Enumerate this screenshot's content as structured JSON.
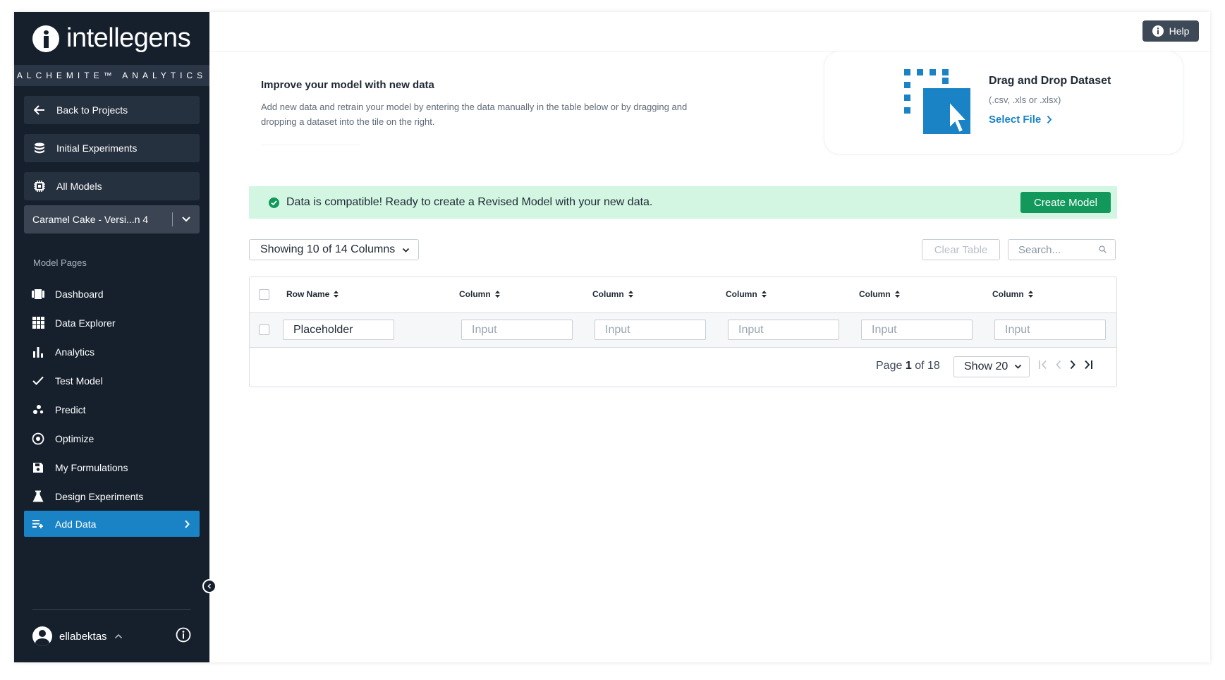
{
  "brand": {
    "name": "intellegens",
    "subtitle": "ALCHEMITE™ ANALYTICS"
  },
  "sidebar": {
    "back_label": "Back to Projects",
    "experiments_label": "Initial Experiments",
    "models_label": "All Models",
    "version_select": "Caramel Cake - Versi...n 4",
    "section_label": "Model Pages",
    "items": [
      {
        "label": "Dashboard",
        "icon": "dashboard-icon"
      },
      {
        "label": "Data Explorer",
        "icon": "grid-icon"
      },
      {
        "label": "Analytics",
        "icon": "bar-chart-icon"
      },
      {
        "label": "Test Model",
        "icon": "check-icon"
      },
      {
        "label": "Predict",
        "icon": "scatter-icon"
      },
      {
        "label": "Optimize",
        "icon": "target-icon"
      },
      {
        "label": "My Formulations",
        "icon": "save-icon"
      },
      {
        "label": "Design Experiments",
        "icon": "flask-icon"
      },
      {
        "label": "Add Data",
        "icon": "add-list-icon",
        "active": true
      }
    ],
    "user": "ellabektas"
  },
  "header": {
    "help_label": "Help"
  },
  "intro": {
    "title": "Improve your model with new data",
    "text": "Add new data and retrain your model by entering the data manually in the table below or by dragging and dropping a dataset into the tile on the right."
  },
  "drop_tile": {
    "title": "Drag and Drop Dataset",
    "formats": "(.csv, .xls or .xlsx)",
    "link": "Select File"
  },
  "alert": {
    "message": "Data is compatible! Ready to create a Revised Model with your new data.",
    "button": "Create Model",
    "color": "#d3f6e3"
  },
  "toolbar": {
    "columns_select": "Showing 10 of 14 Columns",
    "clear_label": "Clear Table",
    "search_placeholder": "Search..."
  },
  "table": {
    "headers": [
      "Row Name",
      "Column",
      "Column",
      "Column",
      "Column",
      "Column"
    ],
    "row": {
      "name": "Placeholder",
      "inputs": [
        "Input",
        "Input",
        "Input",
        "Input",
        "Input"
      ]
    }
  },
  "pagination": {
    "page_prefix": "Page",
    "current": "1",
    "total_text": "of 18",
    "show_select": "Show 20"
  },
  "colors": {
    "sidebar": "#16202d",
    "accent": "#1a83c6",
    "success": "#12985a"
  }
}
